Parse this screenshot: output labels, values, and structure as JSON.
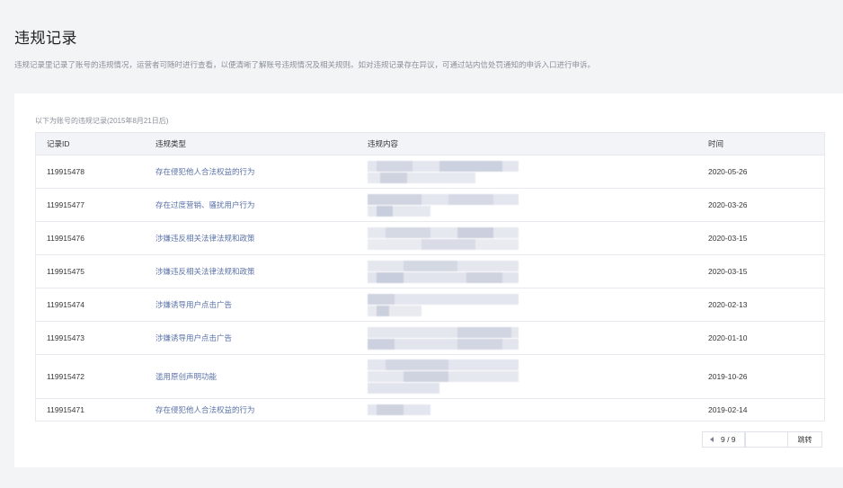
{
  "header": {
    "title": "违规记录",
    "description": "违规记录里记录了账号的违规情况，运营者可随时进行查看，以便清晰了解账号违规情况及相关规则。如对违规记录存在异议，可通过站内信处罚通知的申诉入口进行申诉。"
  },
  "table": {
    "caption": "以下为账号的违规记录(2015年8月21日后)",
    "columns": {
      "id": "记录ID",
      "type": "违规类型",
      "content": "违规内容",
      "time": "时间"
    },
    "rows": [
      {
        "id": "119915478",
        "type": "存在侵犯他人合法权益的行为",
        "time": "2020-05-26"
      },
      {
        "id": "119915477",
        "type": "存在过度营销、骚扰用户行为",
        "time": "2020-03-26"
      },
      {
        "id": "119915476",
        "type": "涉嫌违反相关法律法规和政策",
        "time": "2020-03-15"
      },
      {
        "id": "119915475",
        "type": "涉嫌违反相关法律法规和政策",
        "time": "2020-03-15"
      },
      {
        "id": "119915474",
        "type": "涉嫌诱导用户点击广告",
        "time": "2020-02-13"
      },
      {
        "id": "119915473",
        "type": "涉嫌诱导用户点击广告",
        "time": "2020-01-10"
      },
      {
        "id": "119915472",
        "type": "滥用原创声明功能",
        "time": "2019-10-26"
      },
      {
        "id": "119915471",
        "type": "存在侵犯他人合法权益的行为",
        "time": "2019-02-14"
      }
    ]
  },
  "pager": {
    "current_total": "9 / 9",
    "jump_value": "",
    "jump_label": "跳转"
  },
  "colors": {
    "link": "#5a72a8",
    "pixelated_content": "#c9cede"
  }
}
